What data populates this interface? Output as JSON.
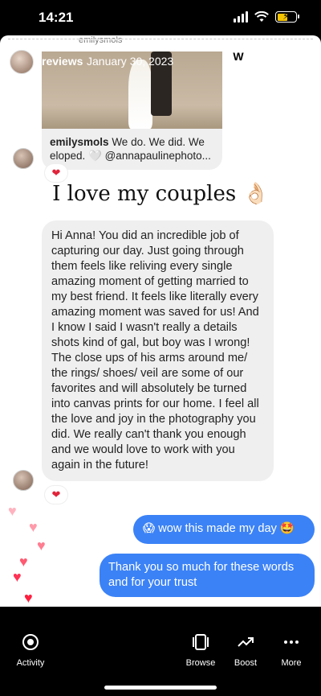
{
  "status": {
    "time": "14:21"
  },
  "story": {
    "top_username": "emilysmols",
    "header_name": "reviews",
    "header_date": "January 30, 2023",
    "shared_post": {
      "username": "emilysmols",
      "caption": "We do. We did. We eloped. 🤍 @annapaulinephoto..."
    },
    "reaction_1": "❤",
    "overlay_text": "I love my couples 👌🏻",
    "incoming_message": "Hi Anna! You did an incredible job of capturing our day. Just going through them feels like reliving every single amazing moment of getting married to my best friend. It feels like literally every amazing moment was saved for us! And I know I said I wasn't really a details shots kind of gal, but boy was I wrong! The close ups of his arms around me/ the rings/ shoes/ veil are some of our favorites and will absolutely be turned into canvas prints for our home. I feel all the love and joy in the photography you did. We really can't thank you enough and we would love to work with you again in the future!",
    "reaction_2": "❤",
    "outgoing_1": "😱 wow this made my day 🤩",
    "outgoing_2": "Thank you so much for these words and for your trust"
  },
  "nav": {
    "activity": "Activity",
    "browse": "Browse",
    "boost": "Boost",
    "more": "More"
  },
  "colors": {
    "outgoing_bubble": "#3b82f6",
    "battery": "#f5c400",
    "heart": "#ff6b81"
  },
  "icons": [
    "wifi-icon",
    "signal-icon",
    "battery-icon",
    "close-icon",
    "save-icon",
    "activity-icon",
    "browse-icon",
    "boost-icon",
    "more-icon"
  ]
}
